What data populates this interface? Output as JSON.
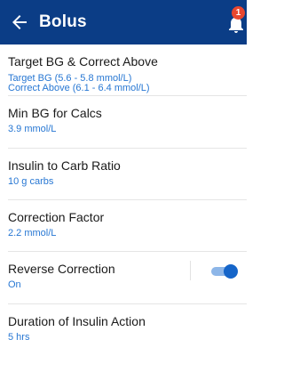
{
  "app_bar": {
    "title": "Bolus",
    "notification_count": "1",
    "colors": {
      "background": "#0b3d86",
      "badge": "#e9472f"
    }
  },
  "settings": [
    {
      "title": "Target BG & Correct Above",
      "values": [
        "Target BG (5.6 - 5.8 mmol/L)",
        "Correct Above (6.1 - 6.4 mmol/L)"
      ]
    },
    {
      "title": "Min BG for Calcs",
      "value": "3.9 mmol/L"
    },
    {
      "title": "Insulin to Carb Ratio",
      "value": "10 g carbs"
    },
    {
      "title": "Correction Factor",
      "value": "2.2 mmol/L"
    },
    {
      "title": "Reverse Correction",
      "value": "On",
      "toggle_on": true
    },
    {
      "title": "Duration of Insulin Action",
      "value": "5 hrs"
    }
  ],
  "colors": {
    "value_text": "#2777d3",
    "toggle": "#1565c9"
  }
}
